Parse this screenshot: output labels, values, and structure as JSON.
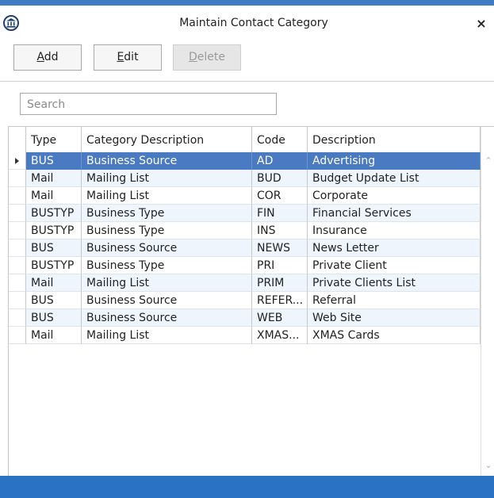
{
  "window": {
    "title": "Maintain Contact Category",
    "close_glyph": "×",
    "app_icon": "building-columns-icon",
    "accent_color": "#3d7cc4",
    "status_bar_color": "#2a72c4"
  },
  "toolbar": {
    "add": {
      "accel": "A",
      "rest": "dd"
    },
    "edit": {
      "accel": "E",
      "rest": "dit"
    },
    "delete": {
      "accel": "D",
      "rest": "elete",
      "disabled": true
    }
  },
  "search": {
    "placeholder": "Search",
    "value": ""
  },
  "grid": {
    "columns": [
      "Type",
      "Category Description",
      "Code",
      "Description"
    ],
    "selected_row_color": "#4a7ac2",
    "rows": [
      {
        "type": "BUS",
        "category": "Business Source",
        "code": "AD",
        "description": "Advertising"
      },
      {
        "type": "Mail",
        "category": "Mailing List",
        "code": "BUD",
        "description": "Budget Update List"
      },
      {
        "type": "Mail",
        "category": "Mailing List",
        "code": "COR",
        "description": "Corporate"
      },
      {
        "type": "BUSTYP",
        "category": "Business Type",
        "code": "FIN",
        "description": "Financial Services"
      },
      {
        "type": "BUSTYP",
        "category": "Business Type",
        "code": "INS",
        "description": "Insurance"
      },
      {
        "type": "BUS",
        "category": "Business Source",
        "code": "NEWS",
        "description": "News Letter"
      },
      {
        "type": "BUSTYP",
        "category": "Business Type",
        "code": "PRI",
        "description": "Private Client"
      },
      {
        "type": "Mail",
        "category": "Mailing List",
        "code": "PRIM",
        "description": "Private Clients List"
      },
      {
        "type": "BUS",
        "category": "Business Source",
        "code": "REFER...",
        "description": "Referral"
      },
      {
        "type": "BUS",
        "category": "Business Source",
        "code": "WEB",
        "description": "Web Site"
      },
      {
        "type": "Mail",
        "category": "Mailing List",
        "code": "XMAS...",
        "description": "XMAS Cards"
      }
    ]
  }
}
